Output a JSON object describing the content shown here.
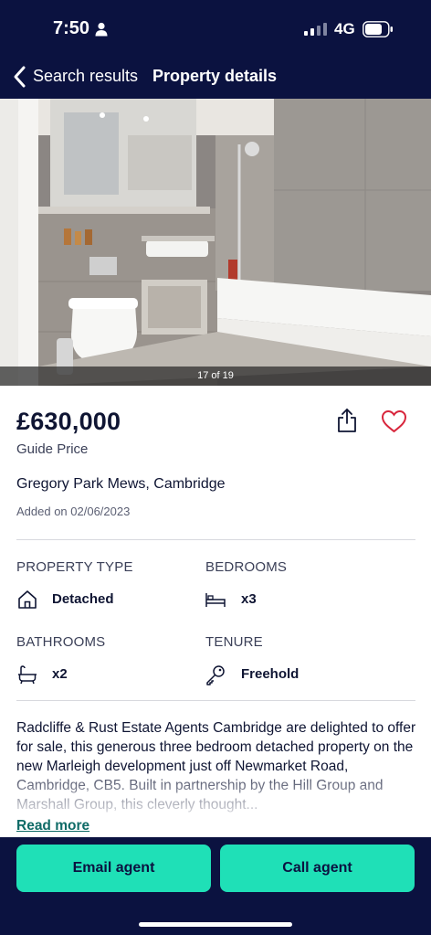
{
  "status_bar": {
    "time": "7:50",
    "network": "4G",
    "icons": [
      "person-icon",
      "signal-icon",
      "battery-icon"
    ]
  },
  "nav": {
    "back_label": "Search results",
    "title": "Property details",
    "back_icon": "chevron-left-icon"
  },
  "gallery": {
    "counter": "17 of 19"
  },
  "listing": {
    "price": "£630,000",
    "price_qualifier": "Guide Price",
    "address": "Gregory Park Mews, Cambridge",
    "added": "Added on 02/06/2023",
    "share_icon": "share-icon",
    "save_icon": "heart-icon"
  },
  "key_features": [
    {
      "label": "PROPERTY TYPE",
      "value": "Detached",
      "icon": "house-icon"
    },
    {
      "label": "BEDROOMS",
      "value": "x3",
      "icon": "bed-icon"
    },
    {
      "label": "BATHROOMS",
      "value": "x2",
      "icon": "bath-icon"
    },
    {
      "label": "TENURE",
      "value": "Freehold",
      "icon": "key-icon"
    }
  ],
  "description": {
    "text": "Radcliffe & Rust Estate Agents Cambridge are delighted to offer for sale, this generous three bedroom detached property on the new Marleigh development just off Newmarket Road, Cambridge, CB5. Built in partnership by the Hill Group and Marshall Group, this cleverly thought...",
    "read_more": "Read more"
  },
  "actions": {
    "email": "Email agent",
    "call": "Call agent"
  },
  "colors": {
    "navy": "#0b1240",
    "accent": "#1fe0b7",
    "link": "#0f6b67",
    "heart": "#d8263c"
  }
}
